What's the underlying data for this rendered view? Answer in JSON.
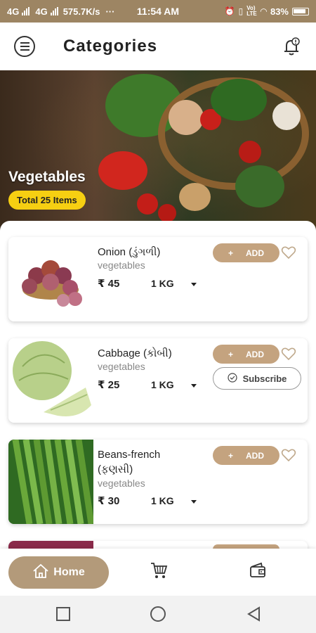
{
  "status_bar": {
    "network1": "4G",
    "network2": "4G",
    "speed": "575.7K/s",
    "more": "···",
    "time": "11:54 AM",
    "battery": "83%"
  },
  "header": {
    "title": "Categories",
    "menu_icon": "hamburger-menu-icon",
    "notification_icon": "bell-icon"
  },
  "hero": {
    "category": "Vegetables",
    "total": "Total 25 Items"
  },
  "products": [
    {
      "name": "Onion (ડુંગળી)",
      "category": "vegetables",
      "price": "₹ 45",
      "quantity": "1 KG",
      "add_label": "ADD",
      "add_symbol": "+"
    },
    {
      "name": "Cabbage (કોબી)",
      "category": "vegetables",
      "price": "₹ 25",
      "quantity": "1 KG",
      "add_label": "ADD",
      "add_symbol": "+",
      "subscribe_label": "Subscribe"
    },
    {
      "name": "Beans-french (ફણસી)",
      "category": "vegetables",
      "price": "₹ 30",
      "quantity": "1 KG",
      "add_label": "ADD",
      "add_symbol": "+"
    }
  ],
  "bottom_nav": {
    "home_label": "Home",
    "cart_icon": "cart-icon",
    "wallet_icon": "wallet-icon"
  },
  "colors": {
    "status_bar": "#9d8563",
    "accent": "#c4a37f",
    "badge": "#f6cf12",
    "home_pill": "#b39a7a"
  }
}
